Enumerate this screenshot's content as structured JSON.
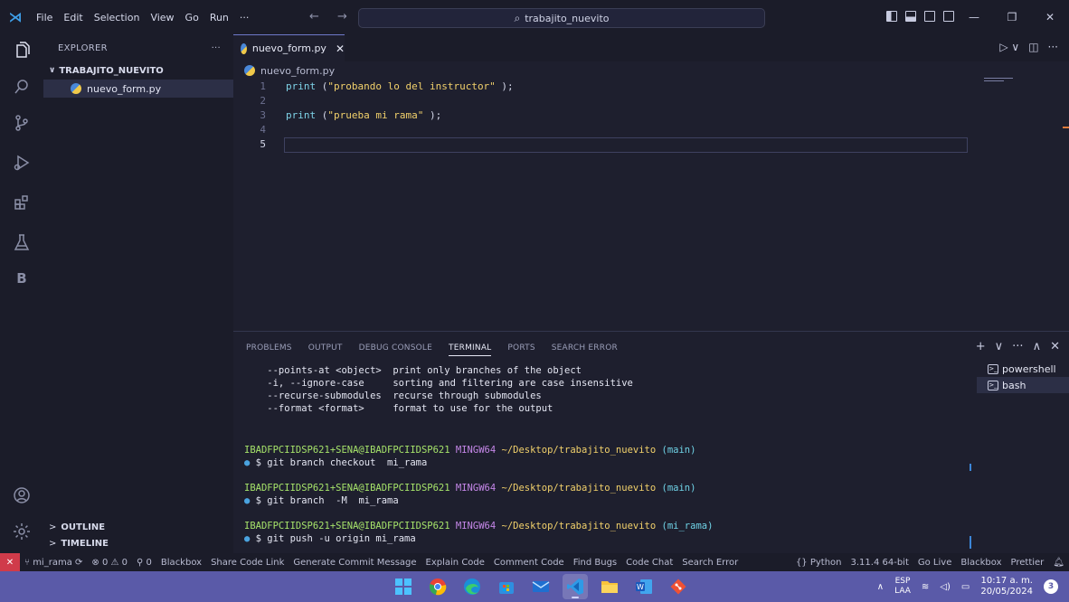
{
  "titlebar": {
    "menu": [
      "File",
      "Edit",
      "Selection",
      "View",
      "Go",
      "Run",
      "···"
    ],
    "search": "trabajito_nuevito",
    "nav_arrows": "← →",
    "window_controls": [
      "—",
      "❐",
      "✕"
    ]
  },
  "sidebar": {
    "title": "EXPLORER",
    "more": "···",
    "folder": "TRABAJITO_NUEVITO",
    "file": "nuevo_form.py",
    "outline": "OUTLINE",
    "timeline": "TIMELINE"
  },
  "activity_letter": "B",
  "editor": {
    "tab_label": "nuevo_form.py",
    "tab_close": "✕",
    "breadcrumb": "nuevo_form.py",
    "line_numbers": [
      "1",
      "2",
      "3",
      "4",
      "5"
    ],
    "lines": [
      {
        "kw": "print",
        "open": " (",
        "str": "\"probando lo del instructor\"",
        "close": " );"
      },
      {
        "kw": "",
        "open": "",
        "str": "",
        "close": ""
      },
      {
        "kw": "print",
        "open": " (",
        "str": "\"prueba mi rama\"",
        "close": " );"
      },
      {
        "kw": "",
        "open": "",
        "str": "",
        "close": ""
      },
      {
        "kw": "",
        "open": "",
        "str": "",
        "close": ""
      }
    ]
  },
  "panel": {
    "tabs": [
      "PROBLEMS",
      "OUTPUT",
      "DEBUG CONSOLE",
      "TERMINAL",
      "PORTS",
      "SEARCH ERROR"
    ],
    "active_tab": "TERMINAL",
    "actions": [
      "+",
      "∨",
      "···",
      "∧",
      "✕"
    ],
    "terminals": [
      "powershell",
      "bash"
    ],
    "selected_terminal": "bash"
  },
  "terminal": {
    "help_lines": [
      {
        "opt": "    --points-at <object>",
        "desc": "  print only branches of the object"
      },
      {
        "opt": "    -i, --ignore-case   ",
        "desc": "  sorting and filtering are case insensitive"
      },
      {
        "opt": "    --recurse-submodules",
        "desc": "  recurse through submodules"
      },
      {
        "opt": "    --format <format>   ",
        "desc": "  format to use for the output"
      }
    ],
    "prompt_user": "IBADFPCIIDSP621+SENA@IBADFPCIIDSP621",
    "prompt_sys": "MINGW64",
    "prompt_path": "~/Desktop/trabajito_nuevito",
    "commands": [
      {
        "branch": "(main)",
        "cmd": "$ git branch checkout  mi_rama"
      },
      {
        "branch": "(main)",
        "cmd": "$ git branch  -M  mi_rama"
      },
      {
        "branch": "(mi_rama)",
        "cmd": "$ git push -u origin mi_rama"
      }
    ]
  },
  "statusbar": {
    "remote": "✕",
    "branch": "mi_rama",
    "errors": "0",
    "warnings": "0",
    "ports": "0",
    "left_items": [
      "Blackbox",
      "Share Code Link",
      "Generate Commit Message",
      "Explain Code",
      "Comment Code",
      "Find Bugs",
      "Code Chat",
      "Search Error"
    ],
    "right_items": [
      "{} Python",
      "3.11.4 64-bit",
      "Go Live",
      "Blackbox",
      "Prettier"
    ]
  },
  "taskbar": {
    "apps": [
      "windows-start",
      "chrome",
      "edge",
      "store",
      "mail",
      "vscode",
      "explorer",
      "word",
      "git"
    ],
    "active_app": "vscode",
    "lang_top": "ESP",
    "lang_bottom": "LAA",
    "time": "10:17 a. m.",
    "date": "20/05/2024",
    "notifications": "3",
    "tray_up": "∧"
  },
  "colors": {
    "accent": "#6e78c8",
    "keyword": "#7fd4e9",
    "string": "#f2d16b",
    "taskbar": "#5a5aa8",
    "remote": "#d03b4a"
  }
}
